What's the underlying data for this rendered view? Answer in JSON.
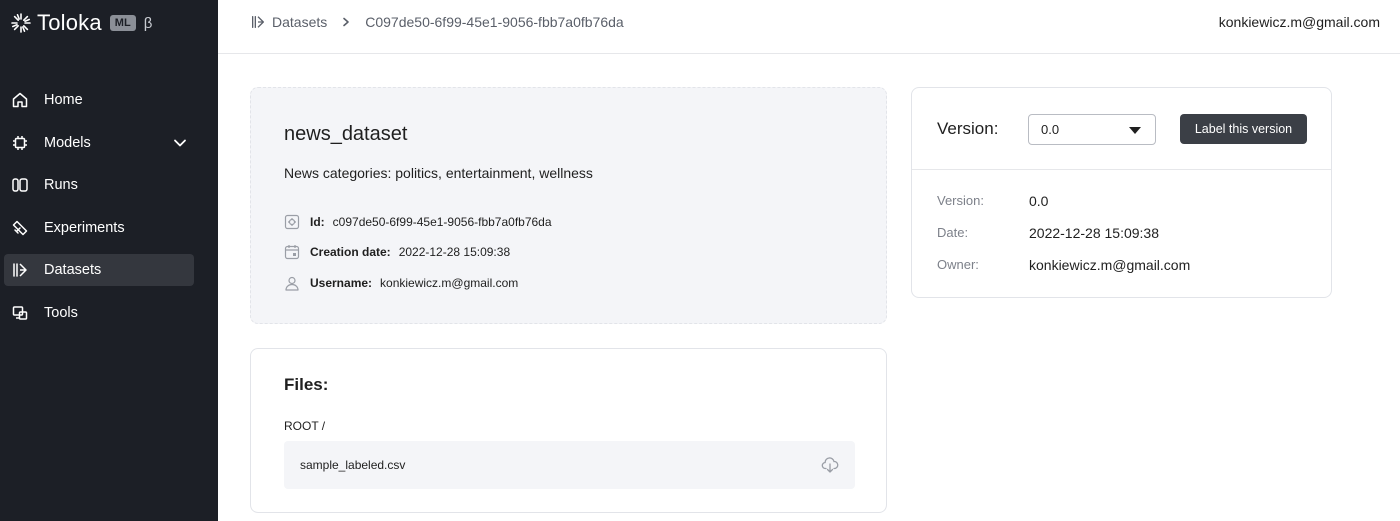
{
  "app": {
    "name": "Toloka",
    "ml_badge": "ML",
    "beta": "β"
  },
  "sidebar": {
    "items": [
      {
        "label": "Home",
        "icon": "home-icon"
      },
      {
        "label": "Models",
        "icon": "chip-icon",
        "expandable": true
      },
      {
        "label": "Runs",
        "icon": "runs-icon"
      },
      {
        "label": "Experiments",
        "icon": "experiments-icon"
      },
      {
        "label": "Datasets",
        "icon": "datasets-icon",
        "active": true
      },
      {
        "label": "Tools",
        "icon": "tools-icon"
      }
    ]
  },
  "header": {
    "breadcrumb": {
      "root": "Datasets",
      "current": "C097de50-6f99-45e1-9056-fbb7a0fb76da"
    },
    "user_email": "konkiewicz.m@gmail.com"
  },
  "dataset": {
    "title": "news_dataset",
    "description": "News categories: politics, entertainment, wellness",
    "id_label": "Id:",
    "id_value": "c097de50-6f99-45e1-9056-fbb7a0fb76da",
    "created_label": "Creation date:",
    "created_value": "2022-12-28 15:09:38",
    "username_label": "Username:",
    "username_value": "konkiewicz.m@gmail.com"
  },
  "files": {
    "title": "Files:",
    "root": "ROOT /",
    "items": [
      {
        "name": "sample_labeled.csv"
      }
    ]
  },
  "version": {
    "label": "Version:",
    "selected": "0.0",
    "label_button": "Label this version",
    "details": [
      {
        "key": "Version:",
        "value": "0.0"
      },
      {
        "key": "Date:",
        "value": "2022-12-28 15:09:38"
      },
      {
        "key": "Owner:",
        "value": "konkiewicz.m@gmail.com"
      }
    ]
  },
  "colors": {
    "sidebar_bg": "#1c1f26",
    "sidebar_active": "#34373e",
    "card_bg": "#f4f5f8",
    "button_bg": "#3b3f46"
  }
}
